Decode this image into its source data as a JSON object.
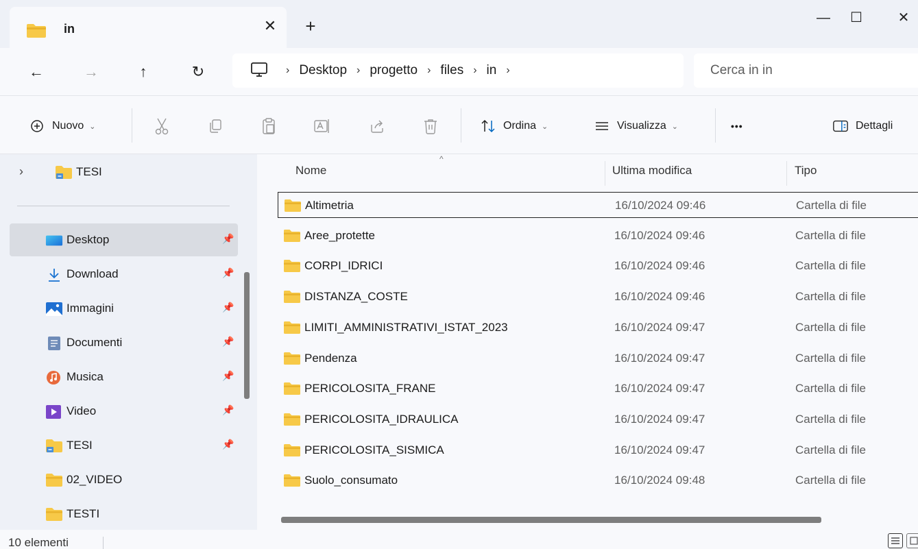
{
  "window": {
    "tab_title": "in",
    "tab_close": "✕",
    "new_tab": "+",
    "minimize": "—",
    "maximize": "☐",
    "close": "✕"
  },
  "nav": {
    "back": "←",
    "forward": "→",
    "up": "↑",
    "refresh": "↻"
  },
  "breadcrumb": [
    "Desktop",
    "progetto",
    "files",
    "in"
  ],
  "breadcrumb_separator": "›",
  "search": {
    "placeholder": "Cerca in in"
  },
  "commandbar": {
    "new_label": "Nuovo",
    "sort_label": "Ordina",
    "view_label": "Visualizza",
    "more_label": "•••",
    "details_label": "Dettagli",
    "dropdown_chevron": "⌄"
  },
  "sidebar": {
    "top_item": {
      "label": "TESI",
      "expand": "›"
    },
    "pin_glyph": "📌",
    "items": [
      {
        "label": "Desktop",
        "icon": "desktop-icon",
        "pinned": true,
        "selected": true
      },
      {
        "label": "Download",
        "icon": "download-icon",
        "pinned": true
      },
      {
        "label": "Immagini",
        "icon": "pictures-icon",
        "pinned": true
      },
      {
        "label": "Documenti",
        "icon": "documents-icon",
        "pinned": true
      },
      {
        "label": "Musica",
        "icon": "music-icon",
        "pinned": true
      },
      {
        "label": "Video",
        "icon": "video-icon",
        "pinned": true
      },
      {
        "label": "TESI",
        "icon": "shared-folder-icon",
        "pinned": true
      },
      {
        "label": "02_VIDEO",
        "icon": "folder-icon",
        "pinned": false
      },
      {
        "label": "TESTI",
        "icon": "folder-icon",
        "pinned": false
      }
    ]
  },
  "filelist": {
    "columns": [
      "Nome",
      "Ultima modifica",
      "Tipo"
    ],
    "sort_caret": "^",
    "rows": [
      {
        "name": "Altimetria",
        "modified": "16/10/2024 09:46",
        "type": "Cartella di file"
      },
      {
        "name": "Aree_protette",
        "modified": "16/10/2024 09:46",
        "type": "Cartella di file"
      },
      {
        "name": "CORPI_IDRICI",
        "modified": "16/10/2024 09:46",
        "type": "Cartella di file"
      },
      {
        "name": "DISTANZA_COSTE",
        "modified": "16/10/2024 09:46",
        "type": "Cartella di file"
      },
      {
        "name": "LIMITI_AMMINISTRATIVI_ISTAT_2023",
        "modified": "16/10/2024 09:47",
        "type": "Cartella di file"
      },
      {
        "name": "Pendenza",
        "modified": "16/10/2024 09:47",
        "type": "Cartella di file"
      },
      {
        "name": "PERICOLOSITA_FRANE",
        "modified": "16/10/2024 09:47",
        "type": "Cartella di file"
      },
      {
        "name": "PERICOLOSITA_IDRAULICA",
        "modified": "16/10/2024 09:47",
        "type": "Cartella di file"
      },
      {
        "name": "PERICOLOSITA_SISMICA",
        "modified": "16/10/2024 09:47",
        "type": "Cartella di file"
      },
      {
        "name": "Suolo_consumato",
        "modified": "16/10/2024 09:48",
        "type": "Cartella di file"
      }
    ]
  },
  "status": {
    "count": "10 elementi"
  },
  "colors": {
    "folder": "#f7c948",
    "folder_dark": "#e9b32c",
    "accent": "#0067c0",
    "selected": "#d9dce2"
  }
}
